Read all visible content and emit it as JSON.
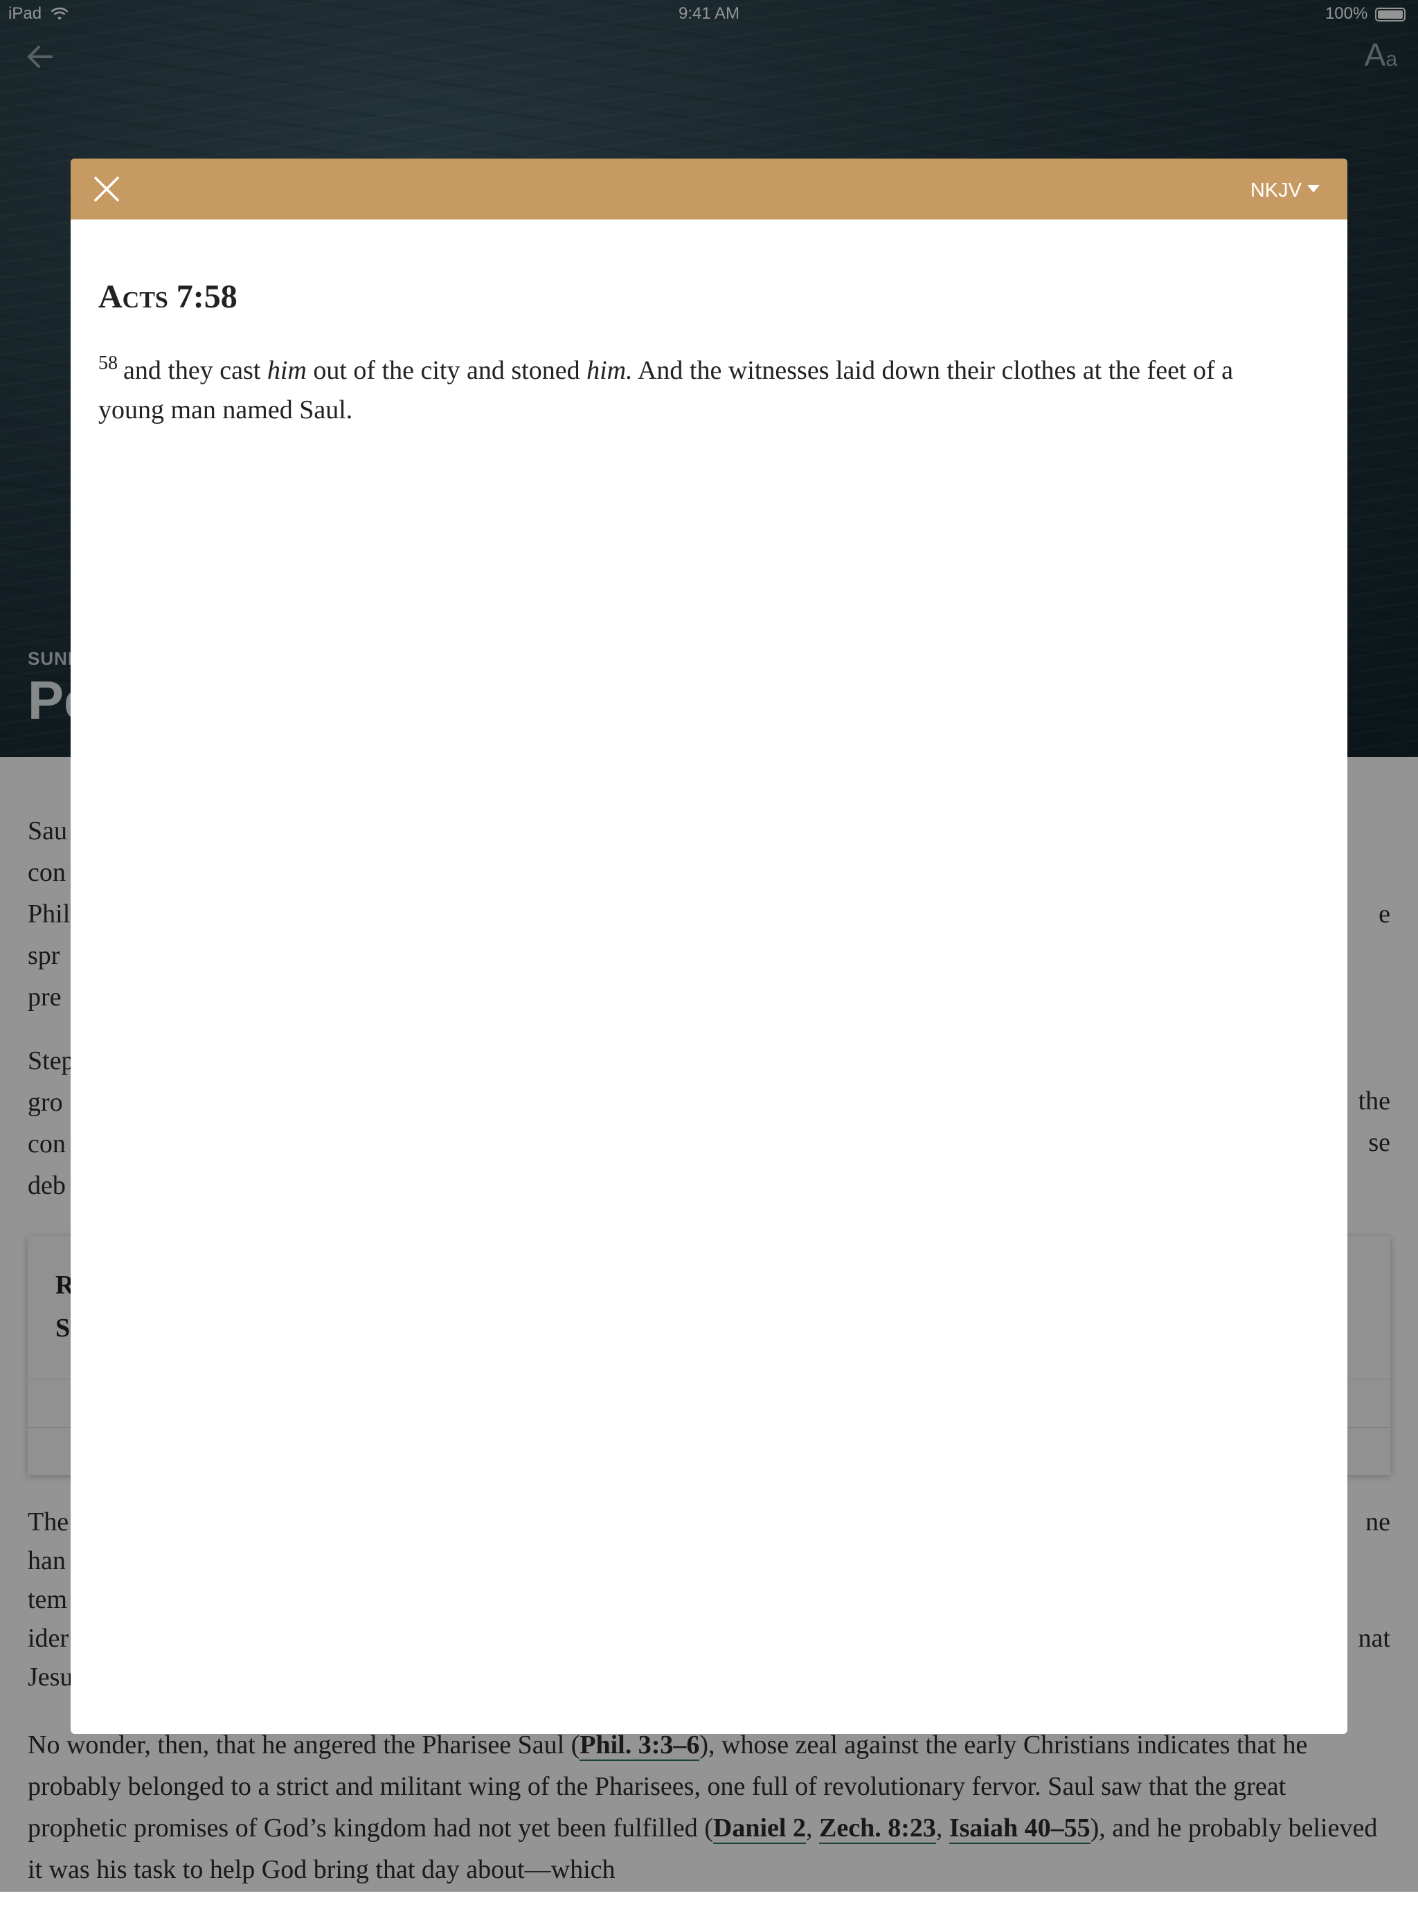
{
  "status_bar": {
    "device": "iPad",
    "time": "9:41 AM",
    "battery": "100%"
  },
  "background": {
    "kicker": "SUND",
    "title": "Pe",
    "paragraphs": [
      {
        "before": "No wonder, then, that he angered the Pharisee Saul (",
        "ref1": "Phil. 3:3–6",
        "middle": "), whose zeal against the early Christians indicates that he probably belonged to a strict and militant wing of the Pharisees, one full of revolutionary fervor. Saul saw that the great prophetic promises of God’s kingdom had not yet been fulfilled (",
        "ref2": "Daniel 2",
        "sep": ", ",
        "ref3": "Zech. 8:23",
        "sep2": ", ",
        "ref4": "Isaiah 40–55",
        "after": "), and he probably believed it was his task to help God bring that day about—which"
      }
    ],
    "fragments": {
      "l1": "Sau",
      "l2": "con",
      "l3": "Phil",
      "l4": "spr",
      "l5": "pre",
      "l6": "Step",
      "l7": "gro",
      "l8": "con",
      "l9": "deb",
      "l10": "The",
      "l11": "han",
      "l12": "tem",
      "l13": "ider",
      "l14": "Jesu",
      "r1": "e",
      "r2": "the",
      "r3": "se",
      "r4": "ne",
      "r5": "nat",
      "c1": "R",
      "c2": "S"
    }
  },
  "modal": {
    "version": "NKJV",
    "reference": "Acts 7:58",
    "verse_number": "58",
    "verse": {
      "t1": "and they cast ",
      "i1": "him",
      "t2": " out of the city and stoned ",
      "i2": "him.",
      "t3": " And the witnesses laid down their clothes at the feet of a young man named Saul."
    }
  }
}
